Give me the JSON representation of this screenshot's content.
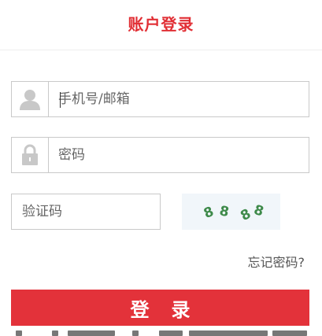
{
  "header": {
    "title": "账户登录"
  },
  "form": {
    "account": {
      "placeholder": "手机号/邮箱",
      "icon": "user-icon"
    },
    "password": {
      "placeholder": "密码",
      "icon": "lock-icon"
    },
    "captcha": {
      "placeholder": "验证码",
      "image_text": "8888"
    },
    "forgot_label": "忘记密码?",
    "login_label": "登录"
  },
  "colors": {
    "accent": "#e12f35",
    "button": "#e3323a",
    "border": "#c9c9c9",
    "icon_gray": "#c8c8c8",
    "captcha_bg": "#f1f6fa",
    "captcha_text": "#3e8a4a"
  }
}
